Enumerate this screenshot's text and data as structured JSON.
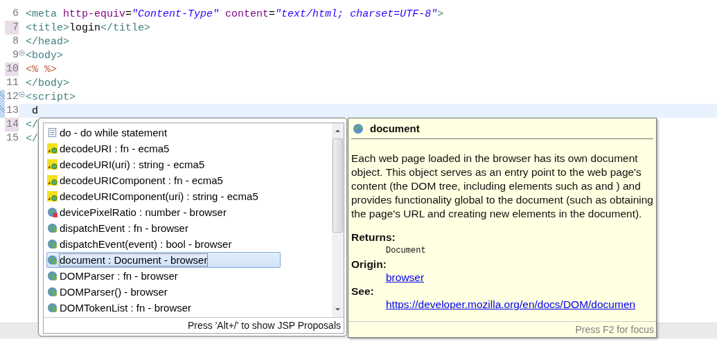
{
  "editor": {
    "lines": [
      {
        "number": "6",
        "fold": false,
        "marker": false,
        "changed": false,
        "current": false,
        "segments": [
          {
            "kind": "tag",
            "text": "<meta "
          },
          {
            "kind": "attr",
            "text": "http-equiv"
          },
          {
            "kind": "text",
            "text": "="
          },
          {
            "kind": "string",
            "text": "\"Content-Type\" "
          },
          {
            "kind": "attr",
            "text": "content"
          },
          {
            "kind": "text",
            "text": "="
          },
          {
            "kind": "string",
            "text": "\"text/html; charset=UTF-8\""
          },
          {
            "kind": "tag",
            "text": ">"
          }
        ]
      },
      {
        "number": "7",
        "fold": false,
        "marker": true,
        "changed": false,
        "current": false,
        "segments": [
          {
            "kind": "tag",
            "text": "<title>"
          },
          {
            "kind": "text",
            "text": "login"
          },
          {
            "kind": "tag",
            "text": "</title>"
          }
        ]
      },
      {
        "number": "8",
        "fold": false,
        "marker": false,
        "changed": false,
        "current": false,
        "segments": [
          {
            "kind": "tag",
            "text": "</head>"
          }
        ]
      },
      {
        "number": "9",
        "fold": true,
        "marker": false,
        "changed": false,
        "current": false,
        "segments": [
          {
            "kind": "tag",
            "text": "<body>"
          }
        ]
      },
      {
        "number": "10",
        "fold": false,
        "marker": true,
        "changed": false,
        "current": false,
        "segments": [
          {
            "kind": "jsp",
            "text": "<% %>"
          }
        ]
      },
      {
        "number": "11",
        "fold": false,
        "marker": false,
        "changed": false,
        "current": false,
        "segments": [
          {
            "kind": "tag",
            "text": "</body>"
          }
        ]
      },
      {
        "number": "12",
        "fold": true,
        "marker": false,
        "changed": true,
        "current": false,
        "segments": [
          {
            "kind": "tag",
            "text": "<script>"
          }
        ]
      },
      {
        "number": "13",
        "fold": false,
        "marker": false,
        "changed": true,
        "current": true,
        "segments": [
          {
            "kind": "text",
            "text": " d"
          }
        ]
      },
      {
        "number": "14",
        "fold": false,
        "marker": true,
        "changed": false,
        "current": false,
        "segments": [
          {
            "kind": "tag",
            "text": "</"
          }
        ]
      },
      {
        "number": "15",
        "fold": false,
        "marker": false,
        "changed": false,
        "current": false,
        "segments": [
          {
            "kind": "tag",
            "text": "</"
          }
        ]
      }
    ]
  },
  "proposals": {
    "items": [
      {
        "kind": "template",
        "label": "do - do while statement",
        "selected": false
      },
      {
        "kind": "function",
        "label": "decodeURI : fn - ecma5",
        "selected": false
      },
      {
        "kind": "function",
        "label": "decodeURI(uri) : string - ecma5",
        "selected": false
      },
      {
        "kind": "function",
        "label": "decodeURIComponent : fn - ecma5",
        "selected": false
      },
      {
        "kind": "function",
        "label": "decodeURIComponent(uri) : string - ecma5",
        "selected": false
      },
      {
        "kind": "browser-field",
        "label": "devicePixelRatio : number - browser",
        "selected": false
      },
      {
        "kind": "browser",
        "label": "dispatchEvent : fn - browser",
        "selected": false
      },
      {
        "kind": "browser",
        "label": "dispatchEvent(event) : bool - browser",
        "selected": false
      },
      {
        "kind": "browser",
        "label": "document : Document - browser",
        "selected": true
      },
      {
        "kind": "browser",
        "label": "DOMParser : fn - browser",
        "selected": false
      },
      {
        "kind": "browser",
        "label": "DOMParser() - browser",
        "selected": false
      },
      {
        "kind": "browser",
        "label": "DOMTokenList : fn - browser",
        "selected": false
      }
    ],
    "footer": "Press 'Alt+/' to show JSP Proposals"
  },
  "doc": {
    "title": "document",
    "description": "Each web page loaded in the browser has its own document object. This object serves as an entry point to the web page's content (the DOM tree, including elements such as and ) and provides functionality global to the document (such as obtaining the page's URL and creating new elements in the document).",
    "returns_label": "Returns:",
    "returns": "Document",
    "origin_label": "Origin:",
    "origin": "browser",
    "see_label": "See:",
    "see": "https://developer.mozilla.org/en/docs/DOM/documen",
    "footer": "Press F2 for focus"
  }
}
